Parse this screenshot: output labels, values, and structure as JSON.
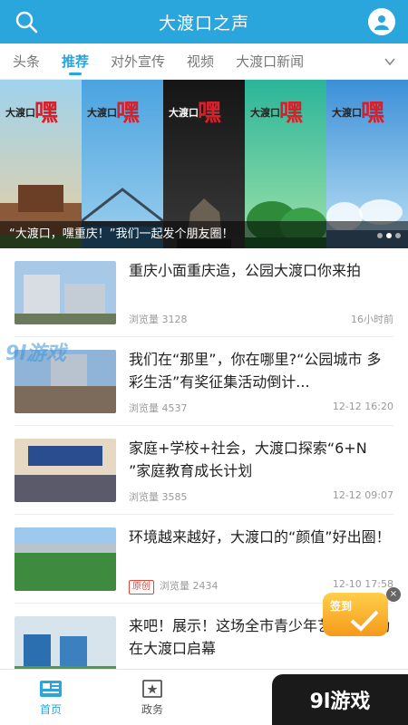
{
  "header": {
    "title": "大渡口之声"
  },
  "tabs": [
    {
      "label": "头条"
    },
    {
      "label": "推荐"
    },
    {
      "label": "对外宣传"
    },
    {
      "label": "视频"
    },
    {
      "label": "大渡口新闻"
    }
  ],
  "banner": {
    "caption": "“大渡口，嘿重庆！”我们一起发个朋友圈！",
    "panels": [
      {
        "brand": "大渡口",
        "hei": "嘿"
      },
      {
        "brand": "大渡口",
        "hei": "嘿"
      },
      {
        "brand": "大渡口",
        "hei": "嘿"
      },
      {
        "brand": "大渡口",
        "hei": "嘿"
      },
      {
        "brand": "大渡口",
        "hei": "嘿"
      }
    ]
  },
  "articles": [
    {
      "headline": "重庆小面重庆造，公园大渡口你来拍",
      "views": "浏览量 3128",
      "time": "16小时前",
      "tag": ""
    },
    {
      "headline": "我们在“那里”，你在哪里?“公园城市 多彩生活”有奖征集活动倒计...",
      "views": "浏览量 4537",
      "time": "12-12 16:20",
      "tag": ""
    },
    {
      "headline": "家庭+学校+社会，大渡口探索“6+N ”家庭教育成长计划",
      "views": "浏览量 3585",
      "time": "12-12 09:07",
      "tag": ""
    },
    {
      "headline": "环境越来越好，大渡口的“颜值”好出圈！",
      "views": "浏览量 2434",
      "time": "12-10 17:58",
      "tag": "原创"
    },
    {
      "headline": "来吧！展示！这场全市青少年艺术节活动在大渡口启幕",
      "views": "",
      "time": "",
      "tag": ""
    }
  ],
  "watermark": "9l游戏",
  "bottom_nav": [
    {
      "label": "首页",
      "icon": "newspaper-icon"
    },
    {
      "label": "政务",
      "icon": "book-star-icon"
    }
  ],
  "checkin": {
    "label": "签到",
    "close": "×"
  },
  "corner_logo": "9l游戏",
  "colors": {
    "accent": "#2aa6dc",
    "tag_red": "#e0483a"
  }
}
